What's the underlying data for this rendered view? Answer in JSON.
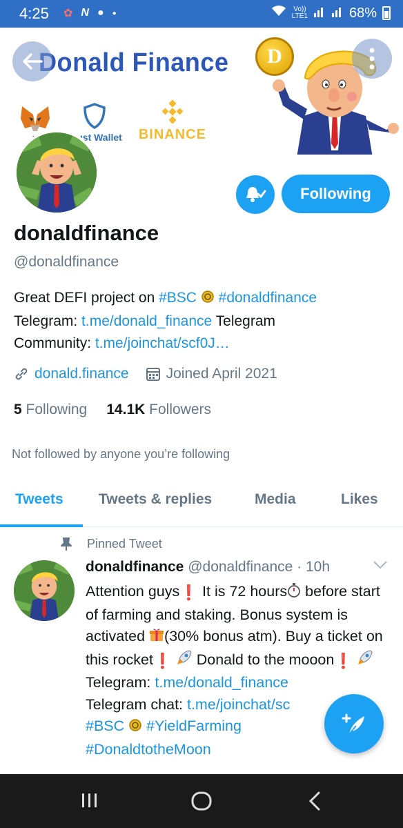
{
  "status_bar": {
    "time": "4:25",
    "network_top": "Vo))",
    "network_bottom": "LTE1",
    "battery": "68%"
  },
  "banner": {
    "title": "Donald Finance",
    "coin_letter": "D",
    "wallets": {
      "metamask_label": "M",
      "trust_label": "Trust Wallet",
      "binance_label": "BINANCE"
    }
  },
  "profile": {
    "display_name": "donaldfinance",
    "handle": "@donaldfinance",
    "following_button": "Following",
    "bio": {
      "line1_text": "Great DEFI project on ",
      "hashtag_bsc": "#BSC",
      "hashtag_donald": "#donaldfinance",
      "line2_label": "Telegram: ",
      "line2_link": "t.me/donald_finance",
      "line2_suffix": " Telegram",
      "line3_label": "Community: ",
      "line3_link": "t.me/joinchat/scf0J…"
    },
    "website": "donald.finance",
    "joined": "Joined April 2021",
    "following_count": "5",
    "following_label": "Following",
    "followers_count": "14.1K",
    "followers_label": "Followers",
    "not_followed": "Not followed by anyone you’re following"
  },
  "tabs": [
    {
      "label": "Tweets",
      "active": true
    },
    {
      "label": "Tweets & replies",
      "active": false
    },
    {
      "label": "Media",
      "active": false
    },
    {
      "label": "Likes",
      "active": false
    }
  ],
  "pinned_tweet": {
    "pinned_label": "Pinned Tweet",
    "author_name": "donaldfinance",
    "author_handle": "@donaldfinance",
    "separator": " · ",
    "time": "10h",
    "segments": {
      "s1": "Attention guys",
      "s2": "It is 72 hours",
      "s3": "before start of farming and staking. Bonus system is activated",
      "s4": "(30% bonus atm). Buy a ticket on this rocket",
      "s5": "Donald to the mooon",
      "telegram_label": "Telegram: ",
      "telegram_link": "t.me/donald_finance",
      "chat_label": "Telegram chat: ",
      "chat_link": "t.me/joinchat/sc",
      "tag_bsc": "#BSC",
      "tag_yield": "#YieldFarming",
      "tag_moon": "#DonaldtotheMoon"
    }
  },
  "colors": {
    "accent": "#1da1f2",
    "status_bar": "#2f6fc5",
    "banner_title": "#2d58b8",
    "binance": "#f3ba2f",
    "trust": "#3375bb",
    "muted": "#657786"
  },
  "icons": {
    "back": "arrow-left-icon",
    "more": "more-vertical-icon",
    "bell": "bell-check-icon",
    "link": "link-icon",
    "calendar": "calendar-icon",
    "pin": "pin-icon",
    "chevron": "chevron-down-icon",
    "compose": "compose-feather-icon"
  }
}
